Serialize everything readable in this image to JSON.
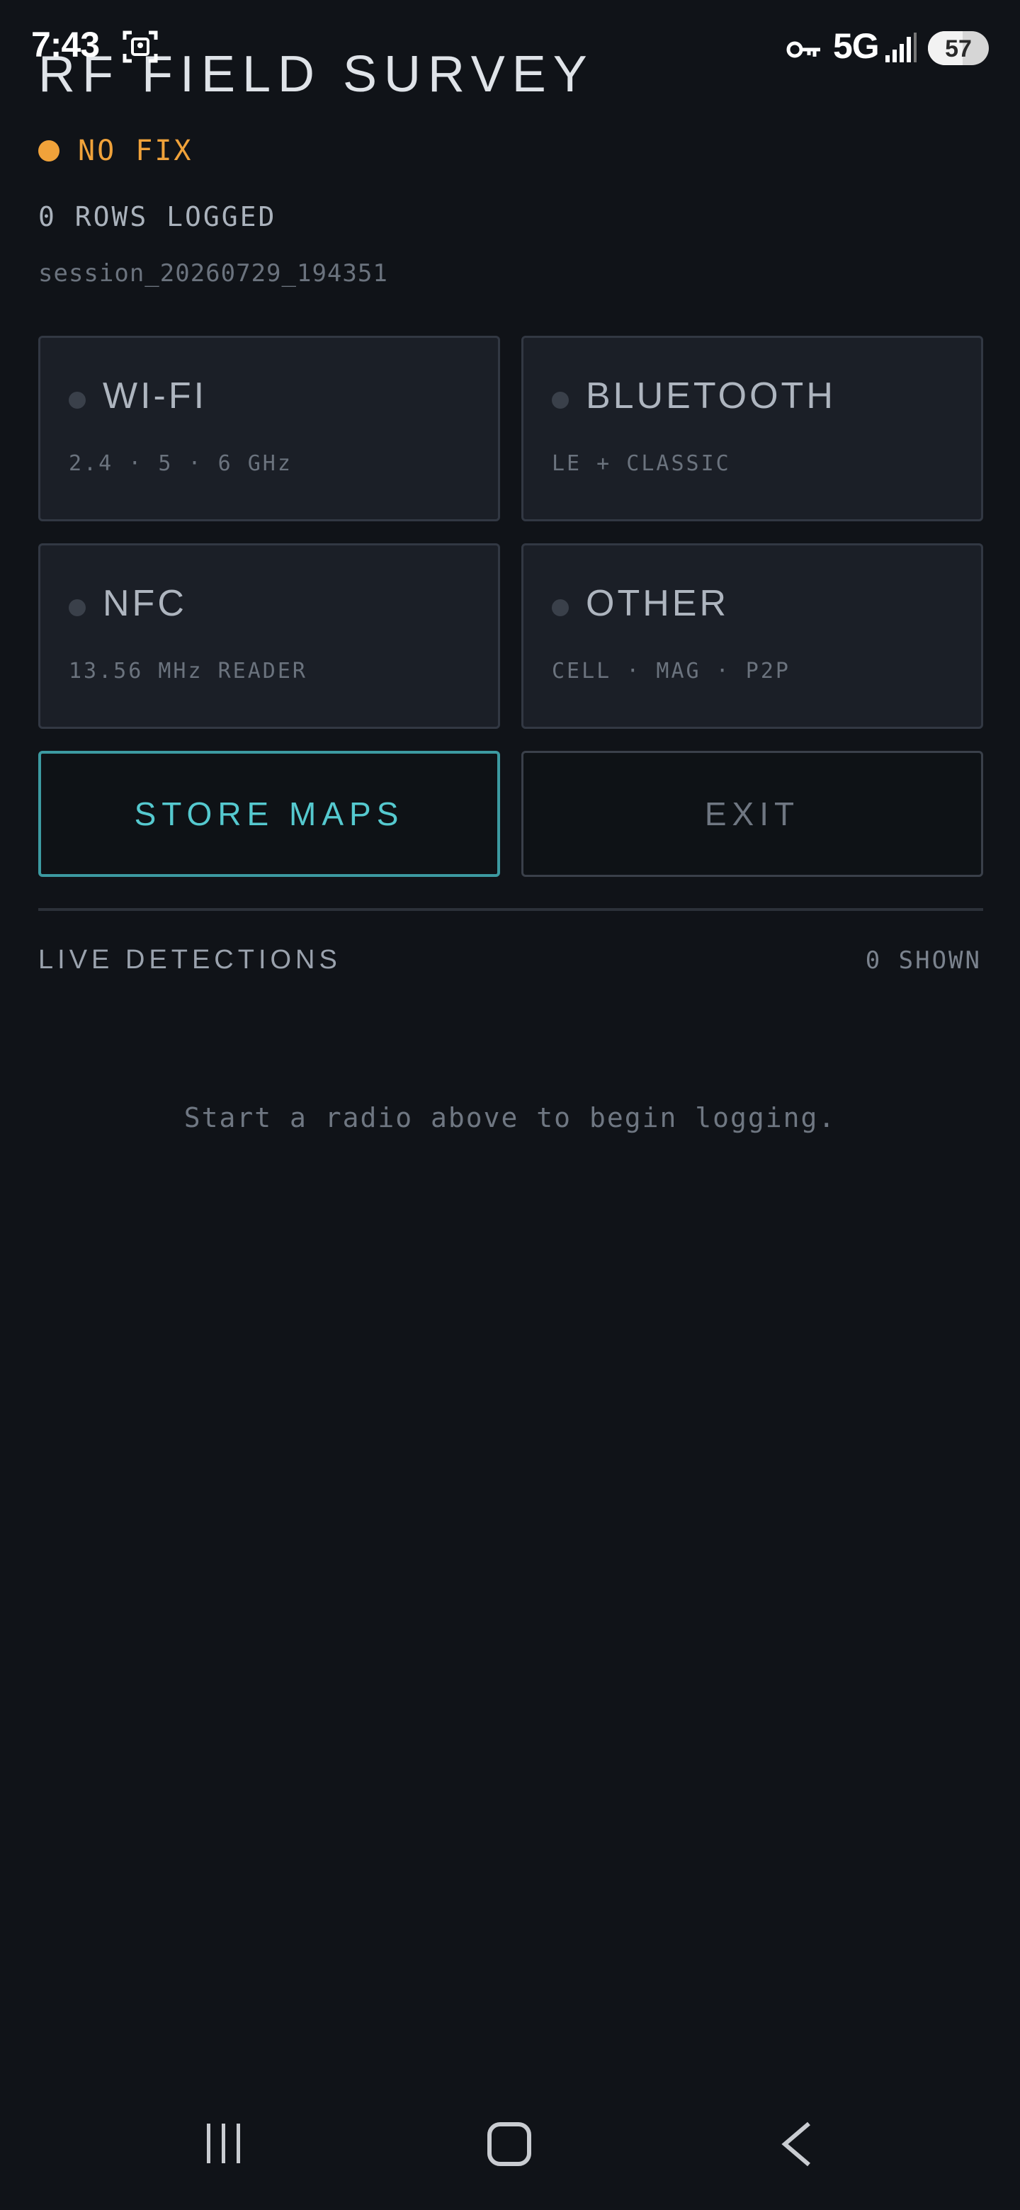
{
  "status_bar": {
    "time": "7:43",
    "network": "5G",
    "battery": "57",
    "battery_level": 0.57,
    "icons": [
      "screenshot-scan-icon",
      "vpn-key-icon",
      "signal-icon",
      "battery-icon"
    ]
  },
  "header": {
    "title": "RF FIELD SURVEY",
    "fix_status": "NO FIX",
    "fix_color": "#f0a23a",
    "rows_logged": "0 ROWS LOGGED",
    "session": "session_20260729_194351"
  },
  "radios": [
    {
      "name": "WI-FI",
      "sub": "2.4 · 5 · 6 GHz"
    },
    {
      "name": "BLUETOOTH",
      "sub": "LE + CLASSIC"
    },
    {
      "name": "NFC",
      "sub": "13.56 MHz READER"
    },
    {
      "name": "OTHER",
      "sub": "CELL · MAG · P2P"
    }
  ],
  "actions": {
    "store_maps": "STORE MAPS",
    "exit": "EXIT",
    "accent_color": "#55c9cf"
  },
  "live": {
    "label": "LIVE DETECTIONS",
    "count": "0 SHOWN",
    "empty_message": "Start a radio above to begin logging."
  },
  "nav": {
    "icons": [
      "recent-apps-icon",
      "home-icon",
      "back-icon"
    ]
  }
}
